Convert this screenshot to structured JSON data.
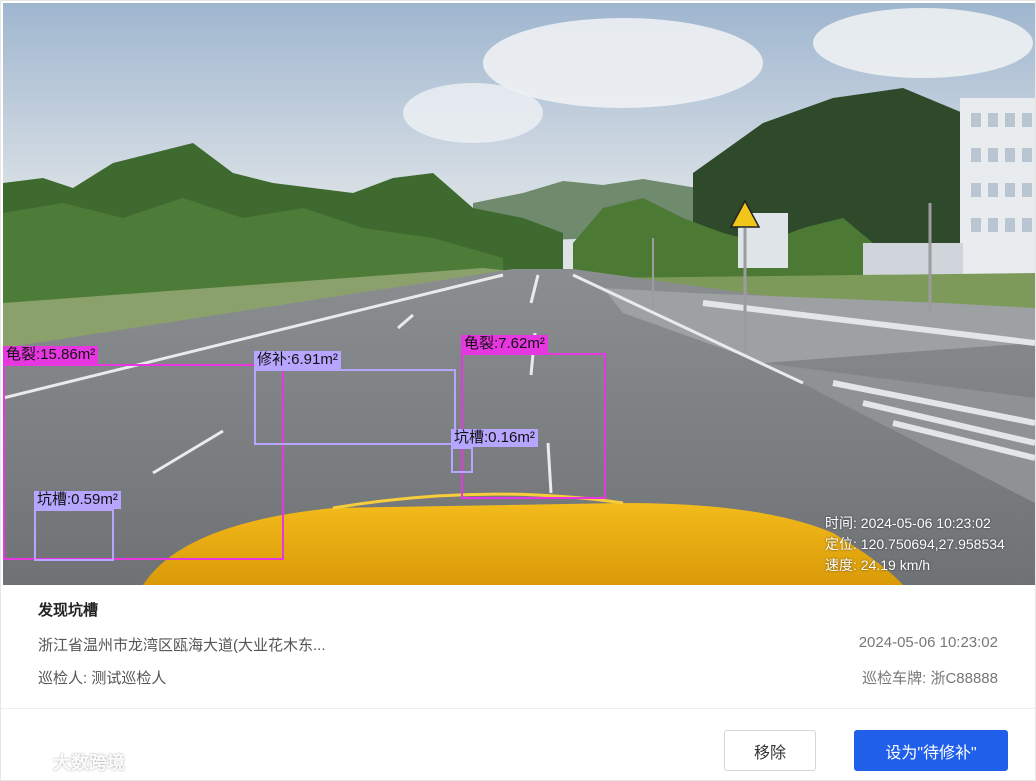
{
  "detections": [
    {
      "type": "crack",
      "label": "龟裂:15.86m²"
    },
    {
      "type": "patch",
      "label": "修补:6.91m²"
    },
    {
      "type": "crack",
      "label": "龟裂:7.62m²"
    },
    {
      "type": "pothole",
      "label": "坑槽:0.16m²"
    },
    {
      "type": "pothole",
      "label": "坑槽:0.59m²"
    }
  ],
  "overlay": {
    "time": "时间: 2024-05-06 10:23:02",
    "location": "定位: 120.750694,27.958534",
    "speed": "速度: 24.19 km/h"
  },
  "info": {
    "title": "发现坑槽",
    "address": "浙江省温州市龙湾区瓯海大道(大业花木东...",
    "datetime": "2024-05-06 10:23:02",
    "inspector": "巡检人: 测试巡检人",
    "plate": "巡检车牌: 浙C88888"
  },
  "actions": {
    "remove": "移除",
    "set_pending": "设为\"待修补\""
  },
  "watermark": "大数跨境",
  "colors": {
    "primary": "#1f5fe9",
    "crack": "#e637e0",
    "pothole": "#b7a6ff"
  }
}
